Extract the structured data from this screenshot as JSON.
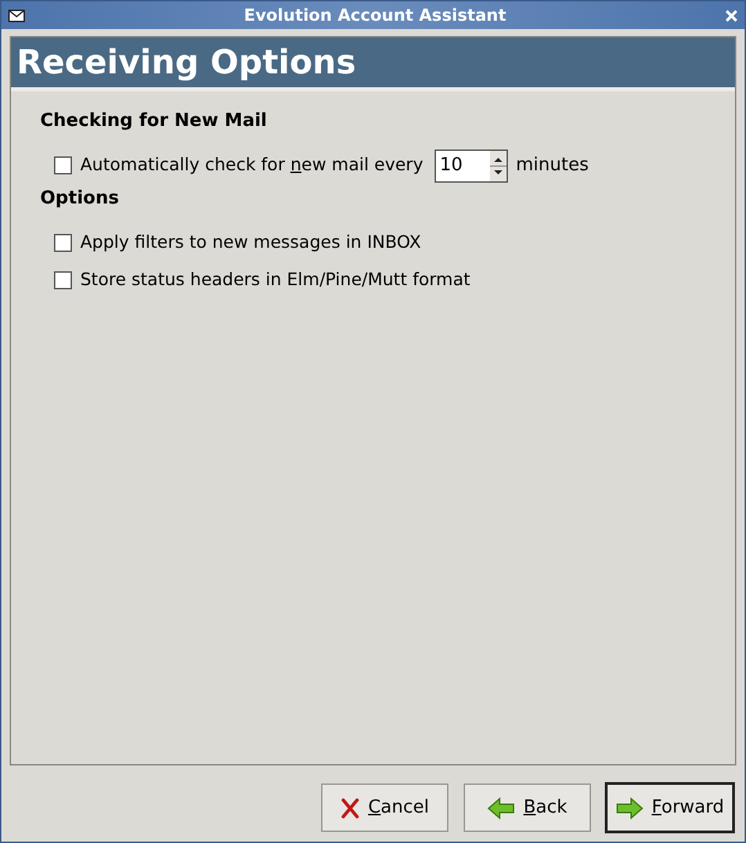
{
  "window": {
    "title": "Evolution Account Assistant"
  },
  "page_title": "Receiving Options",
  "sections": [
    {
      "heading": "Checking for New Mail",
      "items": [
        {
          "kind": "spin",
          "checked": false,
          "label": [
            {
              "text": "Automatically check for ",
              "underline": false
            },
            {
              "text": "n",
              "underline": true
            },
            {
              "text": "ew mail every",
              "underline": false
            }
          ],
          "value": "10",
          "unit": "minutes"
        }
      ]
    },
    {
      "heading": "Options",
      "items": [
        {
          "kind": "check",
          "checked": false,
          "label": [
            {
              "text": "Apply filters to new messages in INBOX",
              "underline": false
            }
          ]
        },
        {
          "kind": "check",
          "checked": false,
          "label": [
            {
              "text": "Store status headers in Elm/Pine/Mutt format",
              "underline": false
            }
          ]
        }
      ]
    }
  ],
  "buttons": [
    {
      "kind": "cancel",
      "default": false,
      "label": [
        {
          "text": "C",
          "underline": true
        },
        {
          "text": "ancel",
          "underline": false
        }
      ]
    },
    {
      "kind": "back",
      "default": false,
      "label": [
        {
          "text": "B",
          "underline": true
        },
        {
          "text": "ack",
          "underline": false
        }
      ]
    },
    {
      "kind": "forward",
      "default": true,
      "label": [
        {
          "text": "F",
          "underline": true
        },
        {
          "text": "orward",
          "underline": false
        }
      ]
    }
  ]
}
